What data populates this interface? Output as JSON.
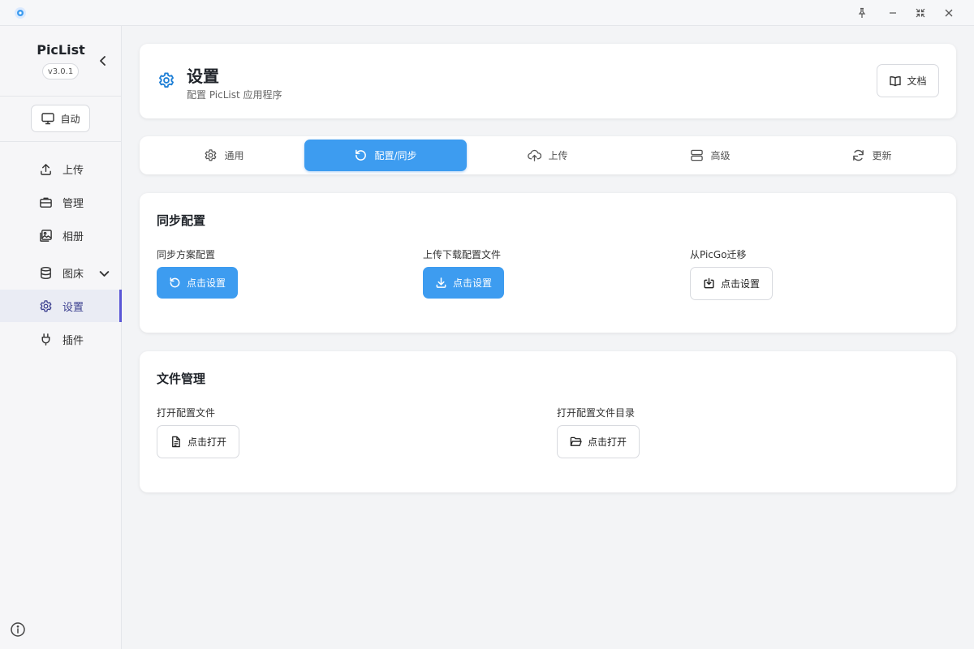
{
  "titlebar": {
    "logo_icon": "app-logo-icon",
    "controls": [
      "pin-icon",
      "minimize-icon",
      "restore-icon",
      "close-icon"
    ]
  },
  "sidebar": {
    "app_name": "PicList",
    "version": "v3.0.1",
    "theme_label": "自动",
    "items": [
      {
        "label": "上传",
        "icon": "upload-icon"
      },
      {
        "label": "管理",
        "icon": "briefcase-icon"
      },
      {
        "label": "相册",
        "icon": "gallery-icon"
      },
      {
        "label": "图床",
        "icon": "database-icon"
      },
      {
        "label": "设置",
        "icon": "gear-icon",
        "active": true
      },
      {
        "label": "插件",
        "icon": "plug-icon"
      }
    ]
  },
  "header": {
    "title": "设置",
    "subtitle": "配置 PicList 应用程序",
    "docs_label": "文档"
  },
  "tabs": [
    {
      "label": "通用",
      "icon": "gear-icon"
    },
    {
      "label": "配置/同步",
      "icon": "undo-icon",
      "active": true
    },
    {
      "label": "上传",
      "icon": "cloud-upload-icon"
    },
    {
      "label": "高级",
      "icon": "server-icon"
    },
    {
      "label": "更新",
      "icon": "refresh-icon"
    }
  ],
  "sync": {
    "title": "同步配置",
    "fields": [
      {
        "label": "同步方案配置",
        "button": "点击设置"
      },
      {
        "label": "上传下载配置文件",
        "button": "点击设置"
      },
      {
        "label": "从PicGo迁移",
        "button": "点击设置"
      }
    ]
  },
  "files": {
    "title": "文件管理",
    "fields": [
      {
        "label": "打开配置文件",
        "button": "点击打开"
      },
      {
        "label": "打开配置文件目录",
        "button": "点击打开"
      }
    ]
  },
  "colors": {
    "accent": "#3d9cf0",
    "active_nav": "#5a56d6",
    "header_icon": "#1e7fd6"
  }
}
